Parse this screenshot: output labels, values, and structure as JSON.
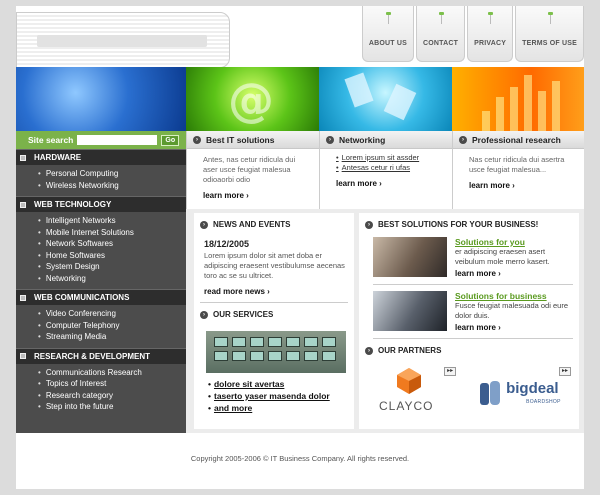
{
  "topnav": [
    {
      "label": "ABOUT US"
    },
    {
      "label": "CONTACT"
    },
    {
      "label": "PRIVACY"
    },
    {
      "label": "TERMS OF USE"
    }
  ],
  "search": {
    "label": "Site search",
    "go": "Go",
    "value": ""
  },
  "sidebar": [
    {
      "title": "HARDWARE",
      "items": [
        "Personal Computing",
        "Wireless Networking"
      ]
    },
    {
      "title": "WEB TECHNOLOGY",
      "items": [
        "Intelligent Networks",
        "Mobile Internet Solutions",
        "Network Softwares",
        "Home Softwares",
        "System Design",
        "Networking"
      ]
    },
    {
      "title": "WEB COMMUNICATIONS",
      "items": [
        "Video Conferencing",
        "Computer Telephony",
        "Streaming Media"
      ]
    },
    {
      "title": "RESEARCH & DEVELOPMENT",
      "items": [
        "Communications Research",
        "Topics of Interest",
        "Research category",
        "Step into the future"
      ]
    }
  ],
  "services": {
    "best_it": {
      "title": "Best IT solutions",
      "text": "Antes, nas cetur ridicula dui aser usce feugiat malesua odioaorbi odio",
      "more": "learn more ›"
    },
    "networking": {
      "title": "Networking",
      "links": [
        "Lorem ipsum sit assder",
        "Antesas cetur ri ufas"
      ],
      "more": "learn more ›"
    },
    "research": {
      "title": "Professional research",
      "text": "Nas cetur ridicula dui asertra usce feugiat malesua...",
      "more": "learn more ›"
    }
  },
  "news": {
    "title": "NEWS AND EVENTS",
    "date": "18/12/2005",
    "text": "Lorem ipsum dolor sit amet doba er adipiscing eraesent vestibulumse aecenas toro ac se su ultricet.",
    "more": "read more news ›"
  },
  "our_services": {
    "title": "OUR SERVICES",
    "links": [
      "dolore sit avertas",
      "taserto yaser masenda dolor",
      "and more"
    ]
  },
  "solutions": {
    "title": "BEST SOLUTIONS FOR YOUR BUSINESS!",
    "items": [
      {
        "title": "Solutions for you",
        "text": "er adipiscing eraesen asert veibulum mole merro kasert.",
        "more": "learn more ›"
      },
      {
        "title": "Solutions for business",
        "text": "Fusce feugiat malesuada odi eure dolor duis.",
        "more": "learn more ›"
      }
    ]
  },
  "partners": {
    "title": "OUR PARTNERS",
    "items": [
      {
        "name": "CLAYCO",
        "arrow": "▸▸"
      },
      {
        "name": "bigdeal",
        "sub": "BOARDSHOP",
        "arrow": "▸▸"
      }
    ]
  },
  "footer": "Copyright 2005-2006 © IT Business Company. All rights reserved.",
  "colors": {
    "accent_green": "#7bb24a",
    "sidebar_bg": "#4c4c4c",
    "link_green": "#5a9a1f"
  }
}
